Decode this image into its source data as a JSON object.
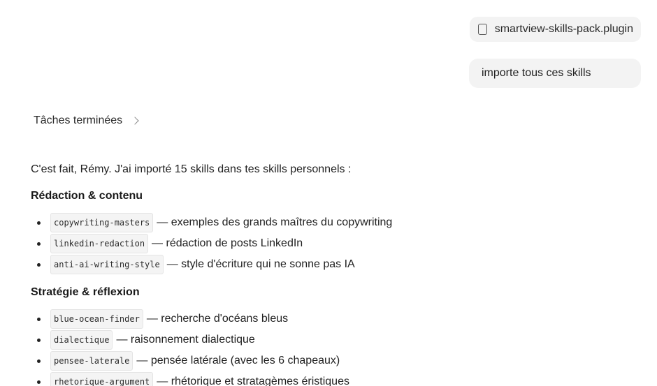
{
  "attachment": {
    "file_name": "smartview-skills-pack.plugin",
    "icon": "file-icon"
  },
  "user_message": "importe tous ces skills",
  "tasks": {
    "label": "Tâches terminées",
    "icon": "chevron-right-icon"
  },
  "reply": {
    "intro": "C'est fait, Rémy. J'ai importé 15 skills dans tes skills personnels :",
    "sections": [
      {
        "heading": "Rédaction & contenu",
        "items": [
          {
            "code": "copywriting-masters",
            "desc": "— exemples des grands maîtres du copywriting"
          },
          {
            "code": "linkedin-redaction",
            "desc": "— rédaction de posts LinkedIn"
          },
          {
            "code": "anti-ai-writing-style",
            "desc": "— style d'écriture qui ne sonne pas IA"
          }
        ]
      },
      {
        "heading": "Stratégie & réflexion",
        "items": [
          {
            "code": "blue-ocean-finder",
            "desc": "— recherche d'océans bleus"
          },
          {
            "code": "dialectique",
            "desc": "— raisonnement dialectique"
          },
          {
            "code": "pensee-laterale",
            "desc": "— pensée latérale (avec les 6 chapeaux)"
          },
          {
            "code": "rhetorique-argument",
            "desc": "— rhétorique et stratagèmes éristiques"
          }
        ]
      }
    ]
  }
}
